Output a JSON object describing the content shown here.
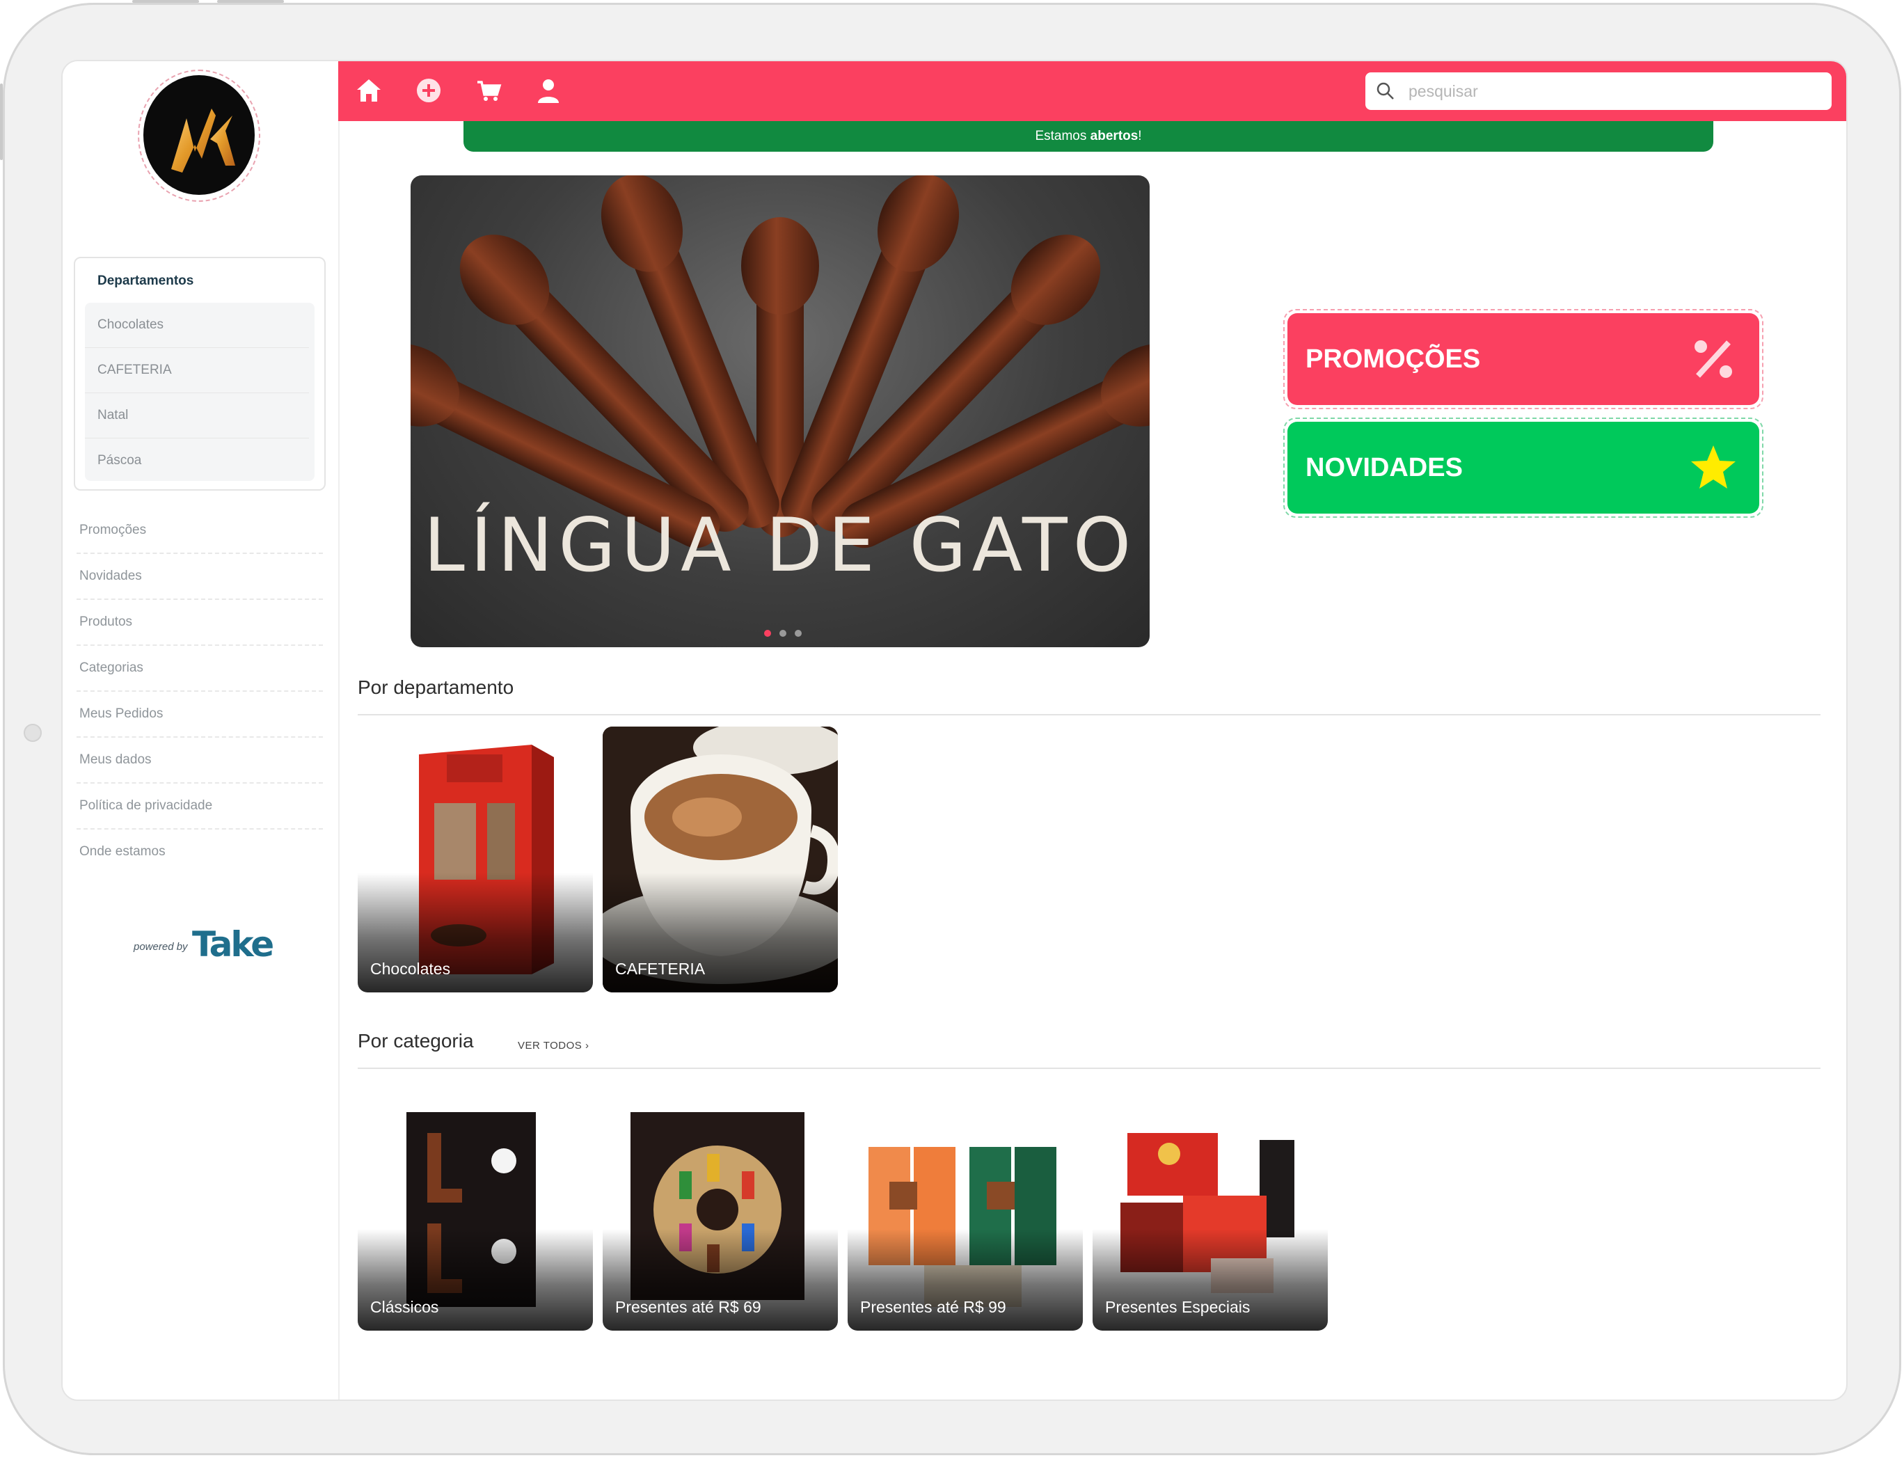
{
  "sidebar": {
    "departments_title": "Departamentos",
    "departments": [
      "Chocolates",
      "CAFETERIA",
      "Natal",
      "Páscoa"
    ],
    "menu": [
      "Promoções",
      "Novidades",
      "Produtos",
      "Categorias",
      "Meus Pedidos",
      "Meus dados",
      "Política de privacidade",
      "Onde estamos"
    ],
    "powered_by": "powered by",
    "powered_brand": "Take"
  },
  "topbar": {
    "icons": [
      "home-icon",
      "add-circle-icon",
      "cart-icon",
      "user-icon"
    ],
    "search_placeholder": "pesquisar"
  },
  "status_banner": {
    "prefix": "Estamos ",
    "status": "abertos",
    "suffix": "!"
  },
  "hero": {
    "title": "LÍNGUA DE GATO",
    "slides": 3,
    "active_slide": 1
  },
  "features": [
    {
      "label": "PROMOÇÕES",
      "icon": "percent-icon",
      "color": "#fb4060"
    },
    {
      "label": "NOVIDADES",
      "icon": "star-icon",
      "color": "#00c95b"
    }
  ],
  "by_department": {
    "title": "Por departamento",
    "items": [
      "Chocolates",
      "CAFETERIA"
    ]
  },
  "by_category": {
    "title": "Por categoria",
    "view_all": "VER TODOS ›",
    "items": [
      "Clássicos",
      "Presentes até R$ 69",
      "Presentes até R$ 99",
      "Presentes Especiais"
    ]
  },
  "colors": {
    "brand_red": "#fb4060",
    "open_green": "#118a40",
    "new_green": "#00c95b"
  }
}
